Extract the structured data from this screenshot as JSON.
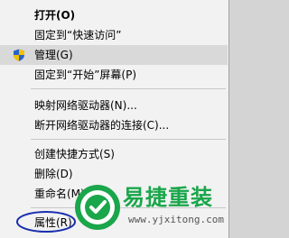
{
  "context_menu": {
    "items": [
      {
        "label": "打开(O)",
        "bold": true
      },
      {
        "label": "固定到“快速访问”"
      },
      {
        "label": "管理(G)",
        "icon": "uac-shield-icon",
        "hover": true
      },
      {
        "label": "固定到“开始”屏幕(P)"
      },
      {
        "label": "映射网络驱动器(N)..."
      },
      {
        "label": "断开网络驱动器的连接(C)..."
      },
      {
        "label": "创建快捷方式(S)"
      },
      {
        "label": "删除(D)"
      },
      {
        "label": "重命名(M)"
      },
      {
        "label": "属性(R)"
      }
    ]
  },
  "watermark": {
    "brand": "易捷重装",
    "url": "www.yjxitong.com",
    "brand_color": "#1aa64a"
  }
}
